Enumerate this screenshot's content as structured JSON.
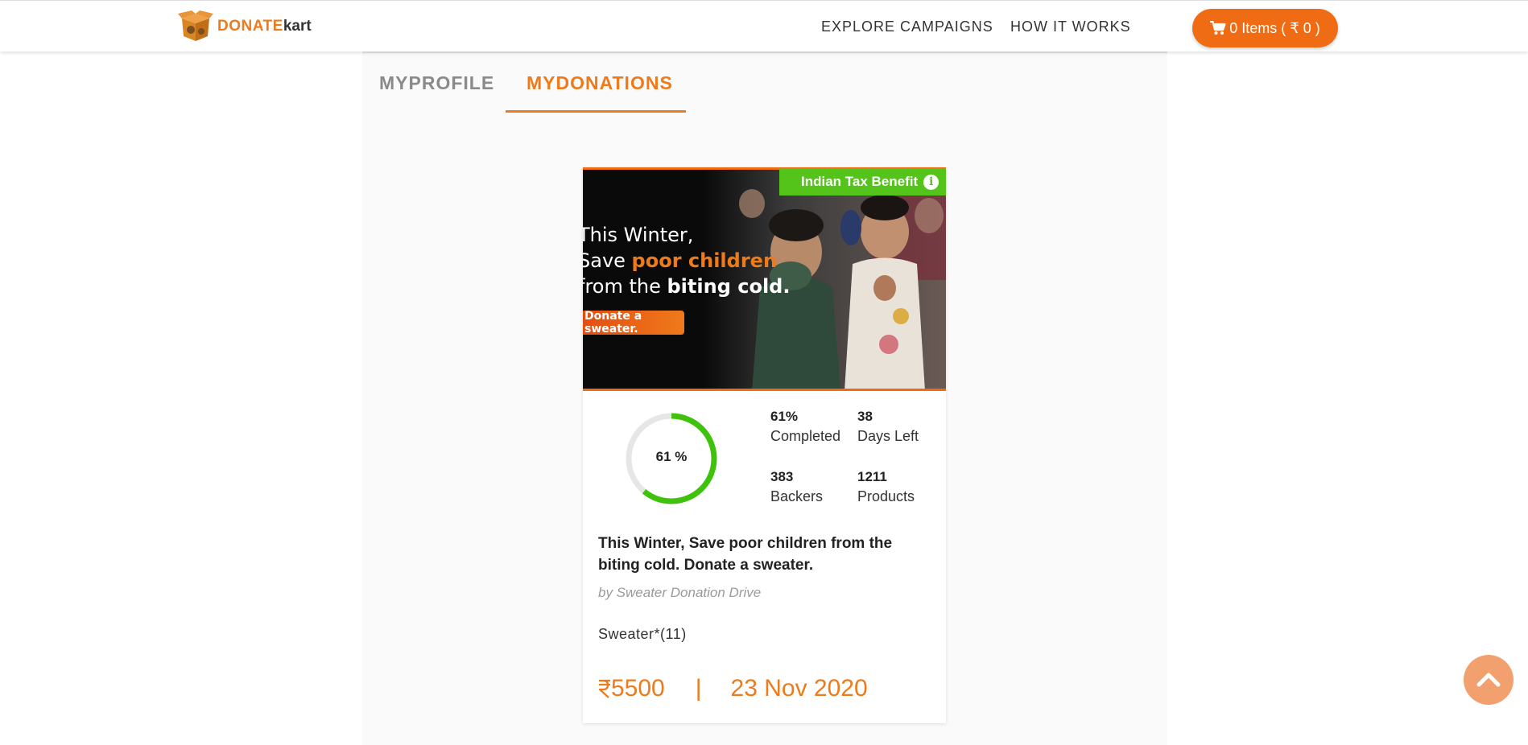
{
  "header": {
    "logo_primary": "DONATE",
    "logo_secondary": "kart",
    "nav": [
      "EXPLORE CAMPAIGNS",
      "HOW IT WORKS"
    ],
    "cart_label": "0 Items ( ₹ 0 )"
  },
  "tabs": [
    {
      "label": "MYPROFILE",
      "active": false
    },
    {
      "label": "MYDONATIONS",
      "active": true
    }
  ],
  "campaign": {
    "banner": {
      "line1": "This Winter,",
      "line2_prefix": "Save ",
      "line2_highlight": "poor children",
      "line3_prefix": "from the ",
      "line3_bold": "biting cold.",
      "cta": "Donate a sweater."
    },
    "badge": "Indian Tax Benefit",
    "progress_percent": 61,
    "progress_label": "61 %",
    "stats": {
      "completed_value": "61%",
      "completed_label": "Completed",
      "days_value": "38",
      "days_label": "Days Left",
      "backers_value": "383",
      "backers_label": "Backers",
      "products_value": "1211",
      "products_label": "Products"
    },
    "title": "This Winter, Save poor children from the biting cold. Donate a sweater.",
    "organizer": "by Sweater Donation Drive",
    "product_line": "Sweater*(11)",
    "amount": "5500",
    "separator": "|",
    "date": "23 Nov 2020"
  },
  "colors": {
    "accent": "#ef7a1a",
    "badge_green": "#54c41a",
    "ring_green": "#3fc20b"
  },
  "icons": [
    "cart-icon",
    "info-icon",
    "rupee-icon",
    "chevron-up-icon"
  ]
}
